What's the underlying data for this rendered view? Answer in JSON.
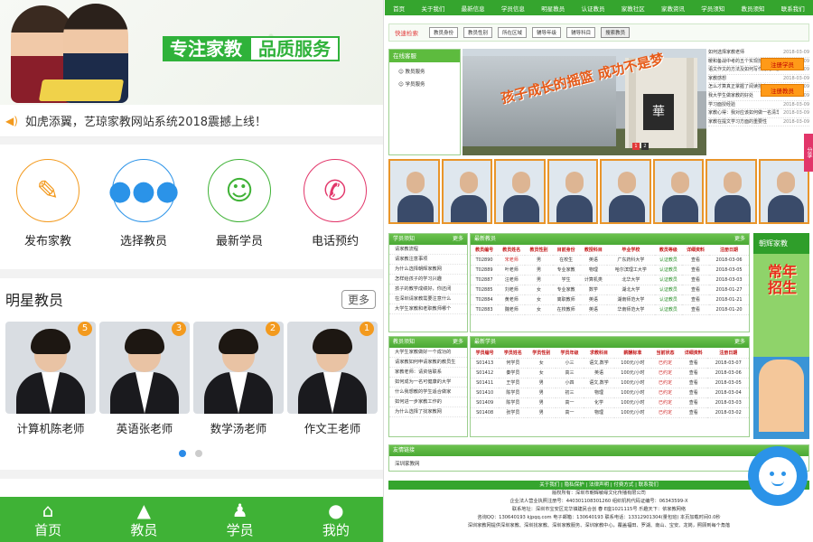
{
  "mobile": {
    "banner": {
      "slogan_1": "专注家教",
      "slogan_2": "品质服务"
    },
    "notice": {
      "text": "如虎添翼，艺琼家教网站系统2018震撼上线！"
    },
    "quick_actions": [
      {
        "label": "发布家教",
        "icon": "pencil-icon",
        "color": "#f39a1e"
      },
      {
        "label": "选择教员",
        "icon": "users-icon",
        "color": "#2b93e8"
      },
      {
        "label": "最新学员",
        "icon": "student-icon",
        "color": "#3fb236"
      },
      {
        "label": "电话预约",
        "icon": "phone-icon",
        "color": "#e2366a"
      }
    ],
    "star_teachers": {
      "title": "明星教员",
      "more_label": "更多",
      "items": [
        {
          "name": "计算机陈老师",
          "rank": "5"
        },
        {
          "name": "英语张老师",
          "rank": "3"
        },
        {
          "name": "数学汤老师",
          "rank": "2"
        },
        {
          "name": "作文王老师",
          "rank": "1"
        }
      ]
    },
    "tabbar": [
      {
        "label": "首页",
        "icon": "home-icon"
      },
      {
        "label": "教员",
        "icon": "graduation-cap-icon"
      },
      {
        "label": "学员",
        "icon": "student-icon"
      },
      {
        "label": "我的",
        "icon": "user-icon"
      }
    ]
  },
  "site": {
    "nav": [
      "首页",
      "关于我们",
      "最新信息",
      "学员信息",
      "明星教员",
      "认证教员",
      "家教社区",
      "家教资讯",
      "学员须知",
      "教员须知",
      "联系我们"
    ],
    "search": {
      "label": "快速检索",
      "selects": [
        "教员身份",
        "教员性别",
        "所在区域",
        "辅导年级",
        "辅导科目"
      ],
      "button": "搜索教员"
    },
    "online": {
      "title": "在线客服",
      "items": [
        "教员服务",
        "学员服务"
      ]
    },
    "banner_text": "孩子成长的摇篮 成功不是梦",
    "banner_pages": [
      "1",
      "2"
    ],
    "news": [
      {
        "t": "如何选择家教老师",
        "d": "2018-03-09"
      },
      {
        "t": "暖和备战中考的五个实现技巧",
        "d": "2018-03-09"
      },
      {
        "t": "语文作文的方法及如何写作好的二教",
        "d": "2018-03-09"
      },
      {
        "t": "家教感想",
        "d": "2018-03-09"
      },
      {
        "t": "怎么才算真正掌握了阅读技力",
        "d": "2018-03-09"
      },
      {
        "t": "我大学生做家教的好处",
        "d": "2018-03-09"
      },
      {
        "t": "学习面授经验",
        "d": "2018-03-09"
      },
      {
        "t": "家教心得：我对应该如何做一名清华大学生",
        "d": "2018-03-09"
      },
      {
        "t": "家教在提文学习方面的重要性",
        "d": "2018-03-09"
      }
    ],
    "reg_buttons": [
      "注册学员",
      "注册教员"
    ],
    "learner_notes": {
      "title": "学员须知",
      "more": "更多",
      "items": [
        "请家教流程",
        "请家教注意事项",
        "为什么选择朝辉家教网",
        "怎样给孩子的学习兴趣",
        "孩子的教学成绩好，你还闭",
        "在深圳请家教需要注意什么",
        "大学生家教和老职教师哪个"
      ]
    },
    "latest_teachers": {
      "title": "最新教员",
      "more": "更多",
      "headers": [
        "教员编号",
        "教员姓名",
        "教员性别",
        "目前身份",
        "教授科目",
        "毕业学校",
        "教员等级",
        "详细资料",
        "注册日期"
      ],
      "rows": [
        [
          "T02890",
          "宋老师",
          "男",
          "在校生",
          "英语",
          "广东药科大学",
          "认证教员",
          "查看",
          "2018-03-06"
        ],
        [
          "T02889",
          "叶老师",
          "男",
          "专业家教",
          "物理",
          "哈尔滨理工大学",
          "认证教员",
          "查看",
          "2018-03-05"
        ],
        [
          "T02887",
          "汪老师",
          "男",
          "学生",
          "计算机类",
          "北华大学",
          "认证教员",
          "查看",
          "2018-03-03"
        ],
        [
          "T02885",
          "刘老师",
          "女",
          "专业家教",
          "数学",
          "湖北大学",
          "认证教员",
          "查看",
          "2018-01-27"
        ],
        [
          "T02884",
          "黄老师",
          "女",
          "离职教师",
          "英语",
          "湖南师范大学",
          "认证教员",
          "查看",
          "2018-01-21"
        ],
        [
          "T02883",
          "魏老师",
          "女",
          "在校教师",
          "英语",
          "华南师范大学",
          "认证教员",
          "查看",
          "2018-01-20"
        ]
      ]
    },
    "teacher_notes": {
      "title": "教员须知",
      "more": "更多",
      "items": [
        "大学生家教做好一个成功的",
        "请家教如何申请家教的教员生",
        "家教老师：请资信联系",
        "如何成为一名可健康的大学",
        "什么我想教的学生适合做家",
        "如何进一步家教工作的",
        "为什么选择了找家教网"
      ]
    },
    "latest_learners": {
      "title": "最新学员",
      "more": "更多",
      "headers": [
        "学员编号",
        "学员姓名",
        "学员性别",
        "学员年级",
        "求教科目",
        "薪酬标准",
        "当前状态",
        "详细资料",
        "注册日期"
      ],
      "rows": [
        [
          "S01413",
          "何学员",
          "女",
          "小三",
          "语文,数学",
          "100元/小时",
          "已约定",
          "查看",
          "2018-03-07"
        ],
        [
          "S01412",
          "秦学员",
          "女",
          "高三",
          "英语",
          "100元/小时",
          "已约定",
          "查看",
          "2018-03-06"
        ],
        [
          "S01411",
          "王学员",
          "男",
          "小四",
          "语文,数学",
          "100元/小时",
          "已约定",
          "查看",
          "2018-03-05"
        ],
        [
          "S01410",
          "陈学员",
          "男",
          "初三",
          "物理",
          "100元/小时",
          "已约定",
          "查看",
          "2018-03-04"
        ],
        [
          "S01409",
          "陈学员",
          "男",
          "高一",
          "化学",
          "100元/小时",
          "已约定",
          "查看",
          "2018-03-03"
        ],
        [
          "S01408",
          "张学员",
          "男",
          "高一",
          "物理",
          "100元/小时",
          "已约定",
          "查看",
          "2018-03-02"
        ]
      ]
    },
    "ad": {
      "brand": "朝辉家教",
      "text": "常年招生"
    },
    "friend_links": {
      "title": "友情链接",
      "items": [
        "深圳家教网"
      ]
    },
    "footer": {
      "bar": "关于我们 | 隐私保护 | 法律声明 | 付费方式 | 联系我们",
      "lines": [
        "版权所有：深圳市朝辉敏缘文化传播有限公司",
        "企业法人营业执照注册号：440301108301260 组织机构代码证编号：06343599-X",
        "联系地址：深圳市宝安区龙华镇建民合创 春 E座1021115号  乐趣天下：依家教网络",
        "咨询QQ：130640193 kjpqq.com 电子邮箱：130640193 联系电话：13312901304(量包班) 本页加载时间0.0秒",
        "深圳家教网提供深圳家教、深圳找家教、深圳家教服务、深圳家教中心，覆盖福田、罗湖、南山、宝安、龙岗，照顾到每个角落"
      ]
    },
    "share_label": "分享"
  }
}
